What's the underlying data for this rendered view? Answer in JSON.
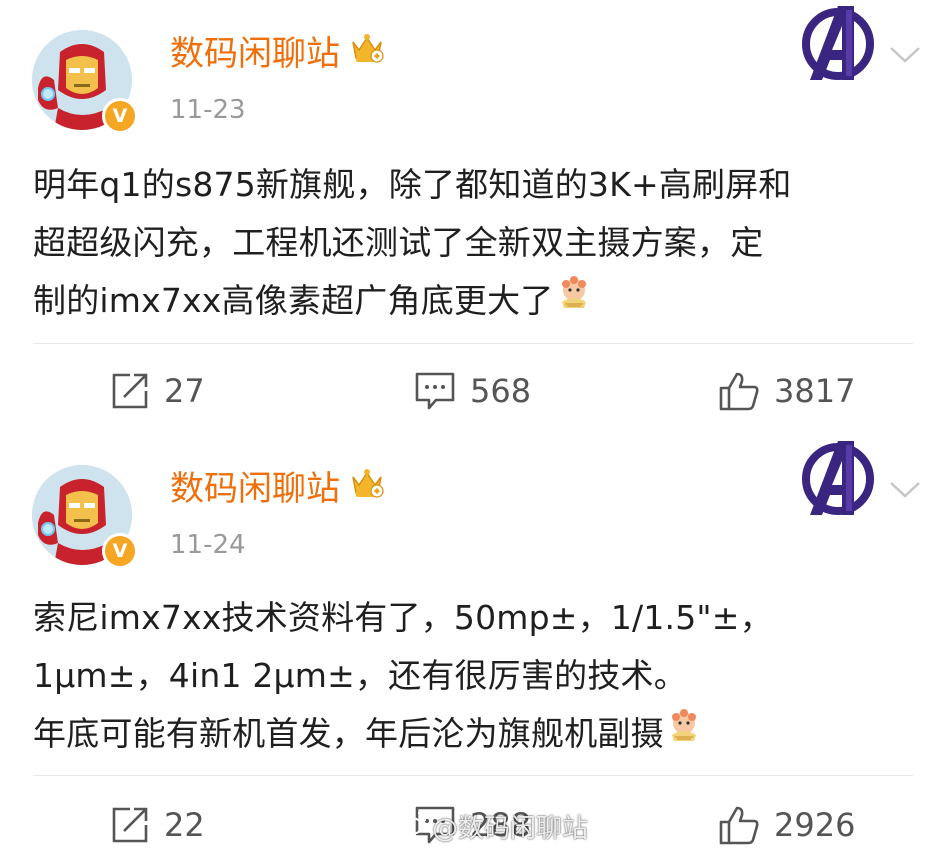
{
  "posts": [
    {
      "username": "数码闲聊站",
      "date": "11-23",
      "verified_badge": "V",
      "text_lines": [
        "明年q1的s875新旗舰，除了都知道的3K+高刷屏和",
        "超超级闪充，工程机还测试了全新双主摄方案，定",
        "制的imx7xx高像素超广角底更大了"
      ],
      "actions": {
        "repost": "27",
        "comment": "568",
        "like": "3817"
      }
    },
    {
      "username": "数码闲聊站",
      "date": "11-24",
      "verified_badge": "V",
      "text_lines": [
        "索尼imx7xx技术资料有了，50mp±，1/1.5\"±，",
        "1μm±，4in1 2μm±，还有很厉害的技术。",
        "年底可能有新机首发，年后沦为旗舰机副摄"
      ],
      "actions": {
        "repost": "22",
        "comment": "288",
        "like": "2926"
      }
    }
  ],
  "icons": {
    "avatar": "iron-man-avatar-icon",
    "verified": "verified-v-icon",
    "membership": "crown-member-icon",
    "fan_badge": "avengers-a-icon",
    "menu": "chevron-down-icon",
    "emoji": "doge-emoji-icon",
    "repost": "repost-icon",
    "comment": "comment-icon",
    "like": "thumbs-up-icon"
  },
  "colors": {
    "username": "#ee6f0b",
    "date": "#999999",
    "body_text": "#1f1f1f",
    "count_text": "#555555",
    "verified_badge": "#f5a623",
    "avengers_purple": "#4b2e8a"
  },
  "watermark": "@数码闲聊站"
}
